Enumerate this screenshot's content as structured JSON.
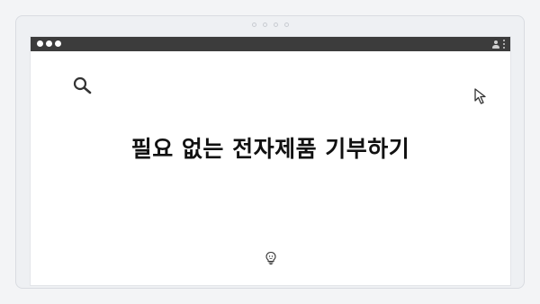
{
  "page": {
    "headline": "필요 없는 전자제품 기부하기"
  },
  "icons": {
    "top_dots": "pagination-dots-icon",
    "traffic_lights": "window-controls-icon",
    "user": "user-icon",
    "menu": "kebab-menu-icon",
    "search": "search-icon",
    "cursor": "cursor-arrow-icon",
    "bulb": "lightbulb-icon"
  },
  "colors": {
    "titlebar": "#3c3c3c",
    "headline_text": "#111111",
    "icon_stroke": "#333333"
  }
}
